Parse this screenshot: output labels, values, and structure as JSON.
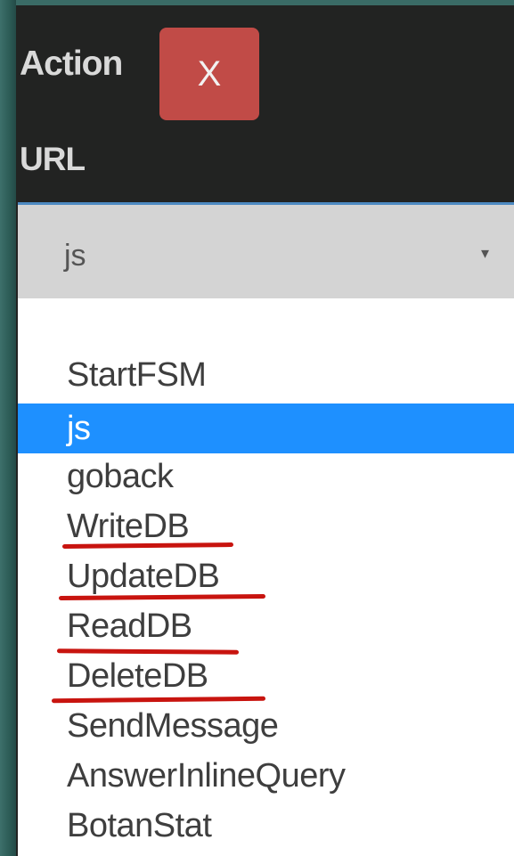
{
  "form": {
    "action_label": "Action",
    "close_label": "X",
    "url_label": "URL"
  },
  "select": {
    "value": "js",
    "arrow": "▾"
  },
  "dropdown": {
    "options": [
      {
        "label": "StartFSM",
        "selected": false,
        "underlined": false
      },
      {
        "label": "js",
        "selected": true,
        "underlined": false
      },
      {
        "label": "goback",
        "selected": false,
        "underlined": false
      },
      {
        "label": "WriteDB",
        "selected": false,
        "underlined": true
      },
      {
        "label": "UpdateDB",
        "selected": false,
        "underlined": true
      },
      {
        "label": "ReadDB",
        "selected": false,
        "underlined": true
      },
      {
        "label": "DeleteDB",
        "selected": false,
        "underlined": true
      },
      {
        "label": "SendMessage",
        "selected": false,
        "underlined": false
      },
      {
        "label": "AnswerInlineQuery",
        "selected": false,
        "underlined": false
      },
      {
        "label": "BotanStat",
        "selected": false,
        "underlined": false
      }
    ]
  },
  "colors": {
    "selected_option": "#1e90ff",
    "close_button": "#c14b47",
    "annotation": "#c8140f"
  }
}
